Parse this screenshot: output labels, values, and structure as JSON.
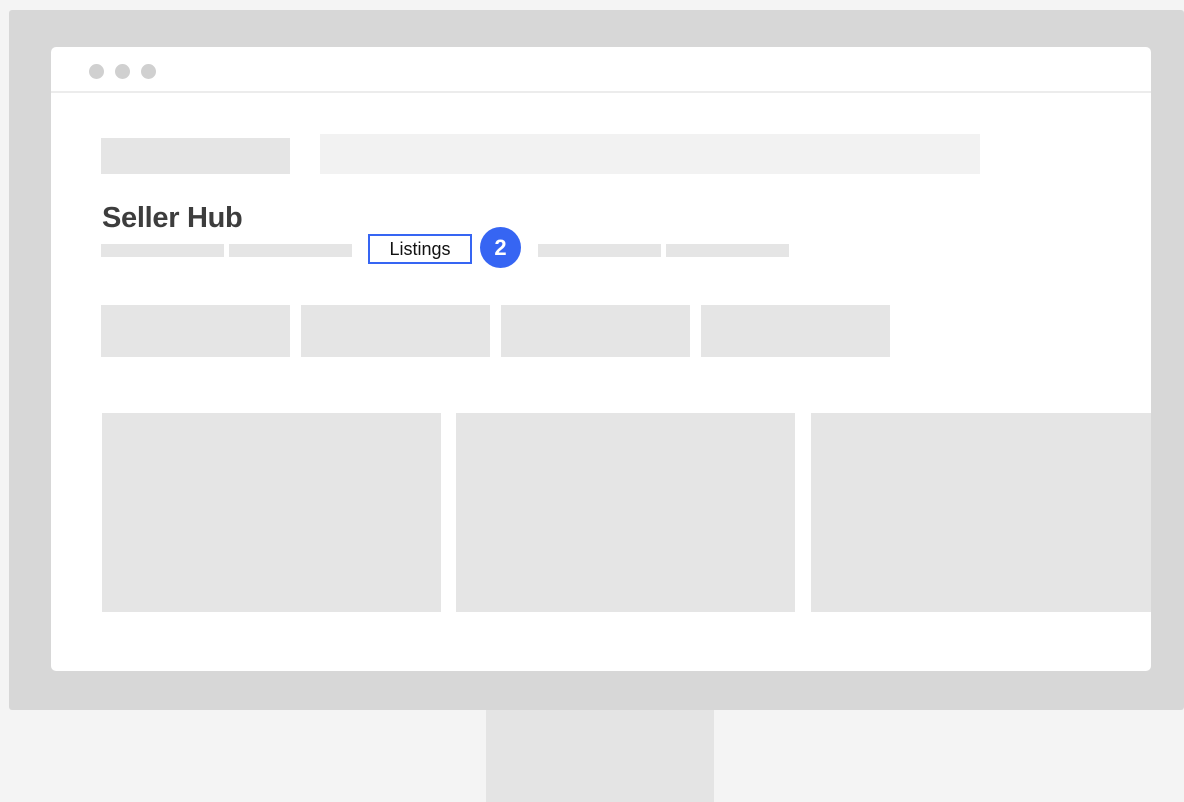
{
  "page": {
    "title": "Seller Hub"
  },
  "nav": {
    "active_tab_label": "Listings",
    "step_number": "2"
  },
  "colors": {
    "accent": "#3665f3",
    "placeholder": "#e5e5e5",
    "placeholder_light": "#f2f2f2",
    "monitor_frame": "#d7d7d7",
    "background": "#f4f4f4"
  }
}
